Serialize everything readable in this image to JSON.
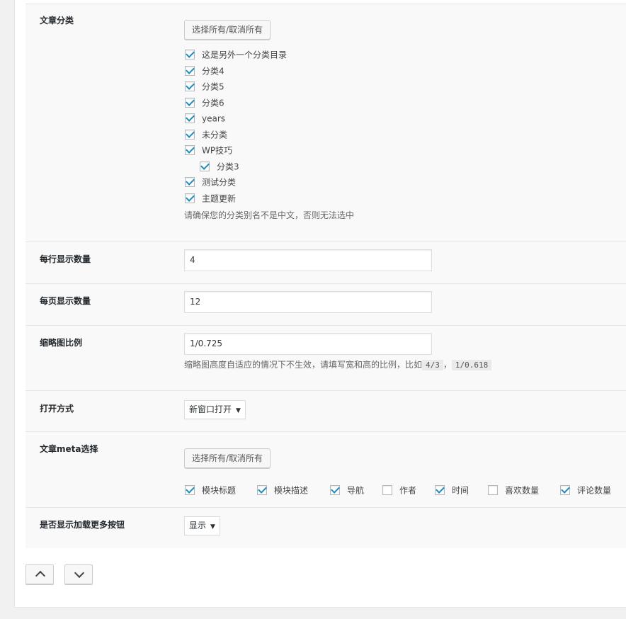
{
  "categories": {
    "label": "文章分类",
    "toggle_all": "选择所有/取消所有",
    "items": [
      {
        "label": "这是另外一个分类目录",
        "checked": true,
        "indent": 0
      },
      {
        "label": "分类4",
        "checked": true,
        "indent": 0
      },
      {
        "label": "分类5",
        "checked": true,
        "indent": 0
      },
      {
        "label": "分类6",
        "checked": true,
        "indent": 0
      },
      {
        "label": "years",
        "checked": true,
        "indent": 0
      },
      {
        "label": "未分类",
        "checked": true,
        "indent": 0
      },
      {
        "label": "WP技巧",
        "checked": true,
        "indent": 0
      },
      {
        "label": "分类3",
        "checked": true,
        "indent": 1
      },
      {
        "label": "测试分类",
        "checked": true,
        "indent": 0
      },
      {
        "label": "主题更新",
        "checked": true,
        "indent": 0
      }
    ],
    "hint": "请确保您的分类别名不是中文，否则无法选中"
  },
  "per_row": {
    "label": "每行显示数量",
    "value": "4"
  },
  "per_page": {
    "label": "每页显示数量",
    "value": "12"
  },
  "thumb_ratio": {
    "label": "缩略图比例",
    "value": "1/0.725",
    "hint": "缩略图高度自适应的情况下不生效，请填写宽和高的比例，比如",
    "example1": "4/3",
    "separator": "，",
    "example2": "1/0.618"
  },
  "open_mode": {
    "label": "打开方式",
    "selected": "新窗口打开"
  },
  "meta": {
    "label": "文章meta选择",
    "toggle_all": "选择所有/取消所有",
    "items": [
      {
        "label": "模块标题",
        "checked": true
      },
      {
        "label": "模块描述",
        "checked": true
      },
      {
        "label": "导航",
        "checked": true
      },
      {
        "label": "作者",
        "checked": false
      },
      {
        "label": "时间",
        "checked": true
      },
      {
        "label": "喜欢数量",
        "checked": false
      },
      {
        "label": "评论数量",
        "checked": true
      }
    ]
  },
  "load_more": {
    "label": "是否显示加载更多按钮",
    "selected": "显示"
  },
  "icons": {
    "move_up": "chevron-up-icon",
    "move_down": "chevron-down-icon",
    "dropdown": "caret-down-icon"
  }
}
